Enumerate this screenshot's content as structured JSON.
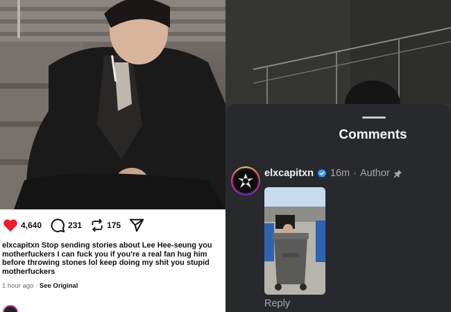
{
  "post": {
    "likes": "4,640",
    "comments": "231",
    "reposts": "175",
    "caption_user": "elxcapitxn",
    "caption_text": "Stop sending stories about Lee Hee-seung you motherfuckers I can fuck you if you're a real fan hug him before throwing stones lol keep doing my shit you stupid motherfuckers",
    "time": "1 hour ago",
    "separator": "·",
    "see_original": "See Original"
  },
  "comments_sheet": {
    "title": "Comments",
    "comment": {
      "username": "elxcapitxn",
      "time": "16m",
      "separator": "·",
      "author_label": "Author",
      "reply_label": "Reply"
    }
  },
  "colors": {
    "like_red": "#ed1c2e",
    "sheet_bg": "#27292d",
    "verified_blue": "#3897f0"
  },
  "icons": [
    "heart-icon",
    "comment-icon",
    "repost-icon",
    "share-icon",
    "verified-icon",
    "pin-icon"
  ]
}
